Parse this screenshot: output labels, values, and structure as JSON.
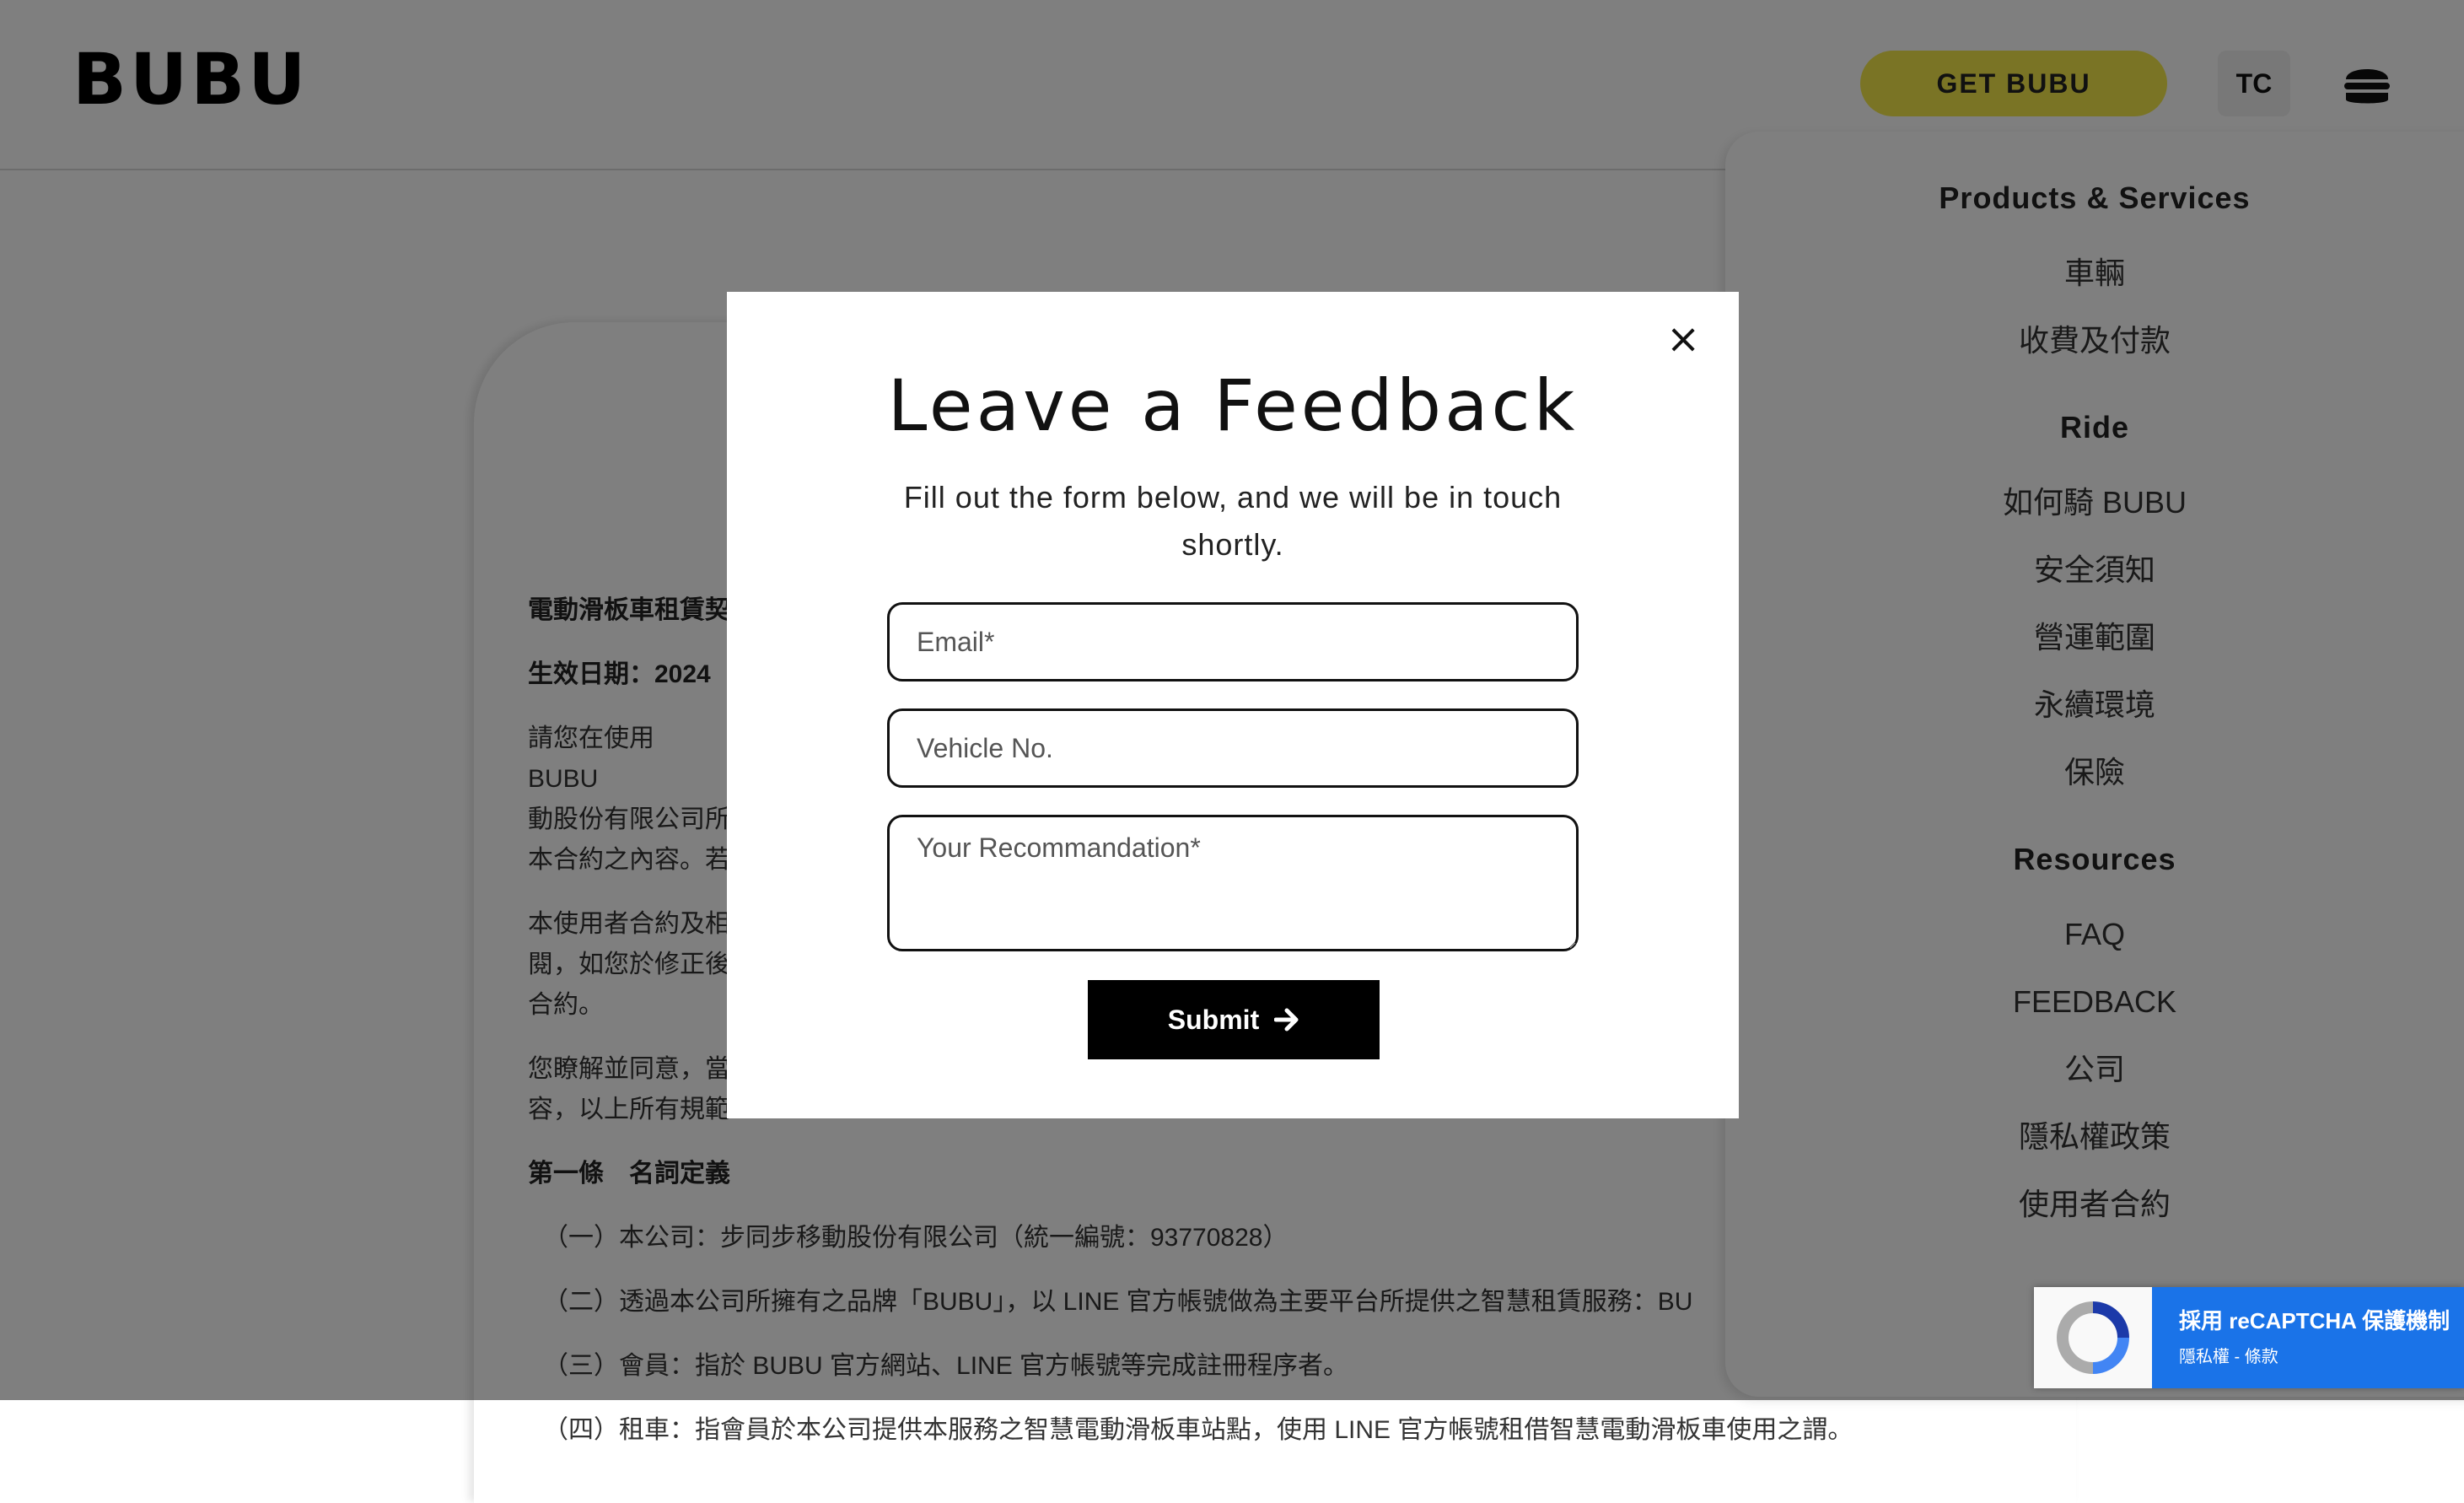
{
  "header": {
    "logo": "BUBU",
    "get_button": "GET BUBU",
    "lang_button": "TC",
    "menu_icon": "hamburger-icon"
  },
  "side_menu": {
    "sections": [
      {
        "title": "Products & Services",
        "links": [
          "車輛",
          "收費及付款"
        ]
      },
      {
        "title": "Ride",
        "links": [
          "如何騎 BUBU",
          "安全須知",
          "營運範圍",
          "永續環境",
          "保險"
        ]
      },
      {
        "title": "Resources",
        "links": [
          "FAQ",
          "FEEDBACK",
          "公司",
          "隱私權政策",
          "使用者合約"
        ]
      }
    ]
  },
  "document": {
    "heading": "電動滑板車租賃契",
    "effective_date": "生效日期：2024",
    "para1": [
      "請您在使用 BUBU",
      "動股份有限公司所",
      "本合約之內容。若"
    ],
    "para2": [
      "本使用者合約及相",
      "閱，如您於修正後",
      "合約。"
    ],
    "para3": [
      "您瞭解並同意，當",
      "容，以上所有規範"
    ],
    "article1_title": "第一條　名詞定義",
    "items": [
      "（一）本公司：步同步移動股份有限公司（統一編號：93770828）",
      "（二）透過本公司所擁有之品牌「BUBU」，以 LINE 官方帳號做為主要平台所提供之智慧租賃服務：BU",
      "（三）會員：指於 BUBU 官方網站、LINE 官方帳號等完成註冊程序者。",
      "（四）租車：指會員於本公司提供本服務之智慧電動滑板車站點，使用 LINE 官方帳號租借智慧電動滑板車使用之謂。"
    ]
  },
  "modal": {
    "title": "Leave a Feedback",
    "subtitle": "Fill out the form below, and we will be in touch shortly.",
    "email_placeholder": "Email*",
    "vehicle_placeholder": "Vehicle No.",
    "recommendation_placeholder": "Your Recommandation*",
    "submit_label": "Submit",
    "close_icon": "close-icon",
    "submit_icon": "arrow-right-icon"
  },
  "recaptcha": {
    "title": "採用 reCAPTCHA 保護機制",
    "links": "隱私權 - 條款"
  },
  "colors": {
    "accent_yellow": "#f5e84a",
    "overlay": "rgba(0,0,0,0.5)",
    "submit_bg": "#000000",
    "recaptcha_blue": "#1a73e8"
  }
}
